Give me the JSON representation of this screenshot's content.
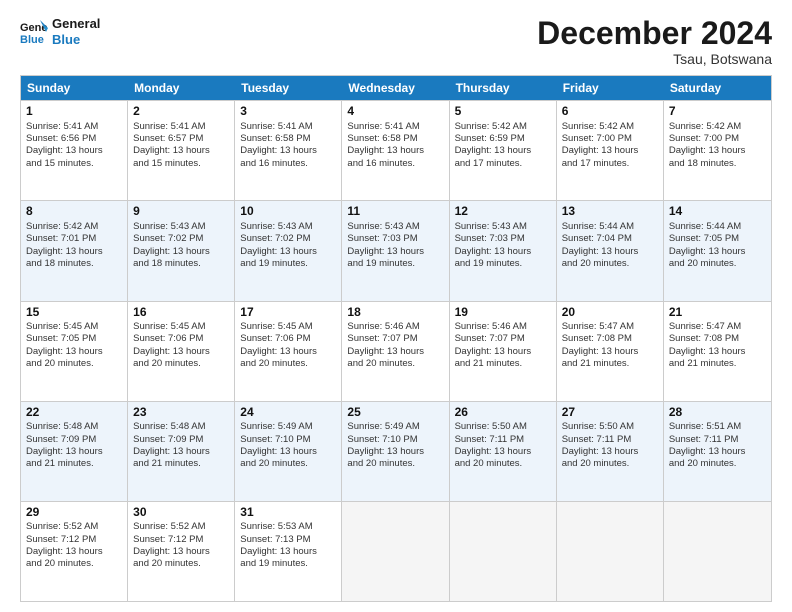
{
  "logo": {
    "line1": "General",
    "line2": "Blue"
  },
  "title": "December 2024",
  "subtitle": "Tsau, Botswana",
  "days": [
    "Sunday",
    "Monday",
    "Tuesday",
    "Wednesday",
    "Thursday",
    "Friday",
    "Saturday"
  ],
  "weeks": [
    [
      {
        "num": "1",
        "sunrise": "5:41 AM",
        "sunset": "6:56 PM",
        "daylight": "13 hours and 15 minutes."
      },
      {
        "num": "2",
        "sunrise": "5:41 AM",
        "sunset": "6:57 PM",
        "daylight": "13 hours and 15 minutes."
      },
      {
        "num": "3",
        "sunrise": "5:41 AM",
        "sunset": "6:58 PM",
        "daylight": "13 hours and 16 minutes."
      },
      {
        "num": "4",
        "sunrise": "5:41 AM",
        "sunset": "6:58 PM",
        "daylight": "13 hours and 16 minutes."
      },
      {
        "num": "5",
        "sunrise": "5:42 AM",
        "sunset": "6:59 PM",
        "daylight": "13 hours and 17 minutes."
      },
      {
        "num": "6",
        "sunrise": "5:42 AM",
        "sunset": "7:00 PM",
        "daylight": "13 hours and 17 minutes."
      },
      {
        "num": "7",
        "sunrise": "5:42 AM",
        "sunset": "7:00 PM",
        "daylight": "13 hours and 18 minutes."
      }
    ],
    [
      {
        "num": "8",
        "sunrise": "5:42 AM",
        "sunset": "7:01 PM",
        "daylight": "13 hours and 18 minutes."
      },
      {
        "num": "9",
        "sunrise": "5:43 AM",
        "sunset": "7:02 PM",
        "daylight": "13 hours and 18 minutes."
      },
      {
        "num": "10",
        "sunrise": "5:43 AM",
        "sunset": "7:02 PM",
        "daylight": "13 hours and 19 minutes."
      },
      {
        "num": "11",
        "sunrise": "5:43 AM",
        "sunset": "7:03 PM",
        "daylight": "13 hours and 19 minutes."
      },
      {
        "num": "12",
        "sunrise": "5:43 AM",
        "sunset": "7:03 PM",
        "daylight": "13 hours and 19 minutes."
      },
      {
        "num": "13",
        "sunrise": "5:44 AM",
        "sunset": "7:04 PM",
        "daylight": "13 hours and 20 minutes."
      },
      {
        "num": "14",
        "sunrise": "5:44 AM",
        "sunset": "7:05 PM",
        "daylight": "13 hours and 20 minutes."
      }
    ],
    [
      {
        "num": "15",
        "sunrise": "5:45 AM",
        "sunset": "7:05 PM",
        "daylight": "13 hours and 20 minutes."
      },
      {
        "num": "16",
        "sunrise": "5:45 AM",
        "sunset": "7:06 PM",
        "daylight": "13 hours and 20 minutes."
      },
      {
        "num": "17",
        "sunrise": "5:45 AM",
        "sunset": "7:06 PM",
        "daylight": "13 hours and 20 minutes."
      },
      {
        "num": "18",
        "sunrise": "5:46 AM",
        "sunset": "7:07 PM",
        "daylight": "13 hours and 20 minutes."
      },
      {
        "num": "19",
        "sunrise": "5:46 AM",
        "sunset": "7:07 PM",
        "daylight": "13 hours and 21 minutes."
      },
      {
        "num": "20",
        "sunrise": "5:47 AM",
        "sunset": "7:08 PM",
        "daylight": "13 hours and 21 minutes."
      },
      {
        "num": "21",
        "sunrise": "5:47 AM",
        "sunset": "7:08 PM",
        "daylight": "13 hours and 21 minutes."
      }
    ],
    [
      {
        "num": "22",
        "sunrise": "5:48 AM",
        "sunset": "7:09 PM",
        "daylight": "13 hours and 21 minutes."
      },
      {
        "num": "23",
        "sunrise": "5:48 AM",
        "sunset": "7:09 PM",
        "daylight": "13 hours and 21 minutes."
      },
      {
        "num": "24",
        "sunrise": "5:49 AM",
        "sunset": "7:10 PM",
        "daylight": "13 hours and 20 minutes."
      },
      {
        "num": "25",
        "sunrise": "5:49 AM",
        "sunset": "7:10 PM",
        "daylight": "13 hours and 20 minutes."
      },
      {
        "num": "26",
        "sunrise": "5:50 AM",
        "sunset": "7:11 PM",
        "daylight": "13 hours and 20 minutes."
      },
      {
        "num": "27",
        "sunrise": "5:50 AM",
        "sunset": "7:11 PM",
        "daylight": "13 hours and 20 minutes."
      },
      {
        "num": "28",
        "sunrise": "5:51 AM",
        "sunset": "7:11 PM",
        "daylight": "13 hours and 20 minutes."
      }
    ],
    [
      {
        "num": "29",
        "sunrise": "5:52 AM",
        "sunset": "7:12 PM",
        "daylight": "13 hours and 20 minutes."
      },
      {
        "num": "30",
        "sunrise": "5:52 AM",
        "sunset": "7:12 PM",
        "daylight": "13 hours and 20 minutes."
      },
      {
        "num": "31",
        "sunrise": "5:53 AM",
        "sunset": "7:13 PM",
        "daylight": "13 hours and 19 minutes."
      },
      null,
      null,
      null,
      null
    ]
  ],
  "labels": {
    "sunrise": "Sunrise:",
    "sunset": "Sunset:",
    "daylight": "Daylight:"
  }
}
